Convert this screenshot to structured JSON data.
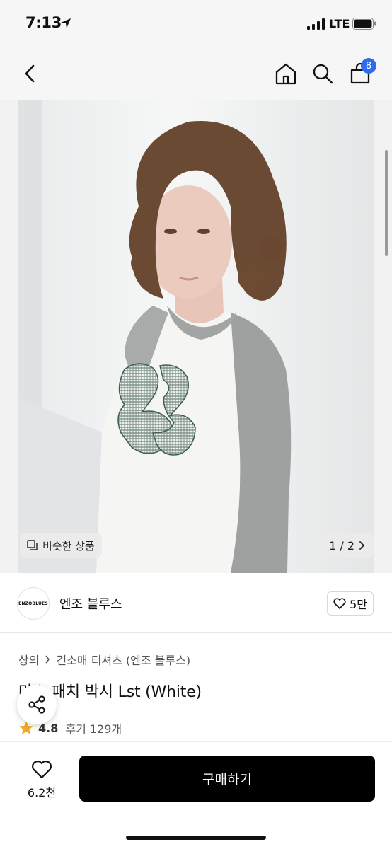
{
  "status": {
    "time": "7:13",
    "network": "LTE"
  },
  "header": {
    "cart_count": "8"
  },
  "gallery": {
    "similar_label": "비슷한 상품",
    "page_indicator": "1 / 2"
  },
  "brand": {
    "logo_text": "ENZOBLUES",
    "name": "엔조 블루스",
    "likes": "5만"
  },
  "breadcrumb": {
    "category": "상의",
    "subcategory": "긴소매 티셔츠 (엔조 블루스)"
  },
  "product": {
    "title_hidden": "마스",
    "title": "패치 박시 Lst (White)",
    "rating": "4.8",
    "reviews": "후기 129개"
  },
  "bottom": {
    "wish_count": "6.2천",
    "buy_label": "구매하기"
  },
  "colors": {
    "badge": "#2d6bf0",
    "star": "#f5a623",
    "buy_bg": "#000000"
  }
}
